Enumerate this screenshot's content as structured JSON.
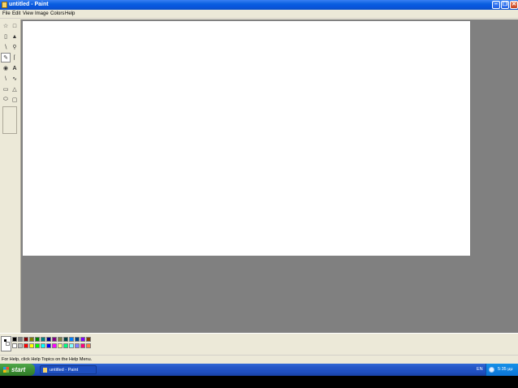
{
  "window": {
    "title": "untitled - Paint",
    "icon": "paint-app-icon",
    "controls": [
      "minimize",
      "maximize",
      "close"
    ]
  },
  "menu": {
    "items": [
      "File",
      "Edit",
      "View",
      "Image",
      "Colors",
      "Help"
    ]
  },
  "tools": {
    "selected": "pencil",
    "icons": [
      "free-select-icon",
      "rect-select-icon",
      "eraser-icon",
      "fill-icon",
      "color-picker-icon",
      "magnifier-icon",
      "pencil-icon",
      "brush-icon",
      "airbrush-icon",
      "text-icon",
      "line-icon",
      "curve-icon",
      "rectangle-icon",
      "polygon-icon",
      "ellipse-icon",
      "rounded-rect-icon"
    ]
  },
  "palette": {
    "foreground": "#000000",
    "background": "#ffffff",
    "colors_top": [
      "#000000",
      "#808080",
      "#800000",
      "#808000",
      "#008000",
      "#008080",
      "#000080",
      "#800080",
      "#808040",
      "#004040",
      "#0080ff",
      "#004080",
      "#8000ff",
      "#804000"
    ],
    "colors_bottom": [
      "#ffffff",
      "#c0c0c0",
      "#ff0000",
      "#ffff00",
      "#00ff00",
      "#00ffff",
      "#0000ff",
      "#ff00ff",
      "#ffff80",
      "#00ff80",
      "#80ffff",
      "#8080ff",
      "#ff0080",
      "#ff8040"
    ]
  },
  "status": {
    "text": "For Help, click Help Topics on the Help Menu."
  },
  "taskbar": {
    "start_label": "start",
    "task_label": "untitled - Paint",
    "language": "EN",
    "clock": "5:35 μμ"
  }
}
